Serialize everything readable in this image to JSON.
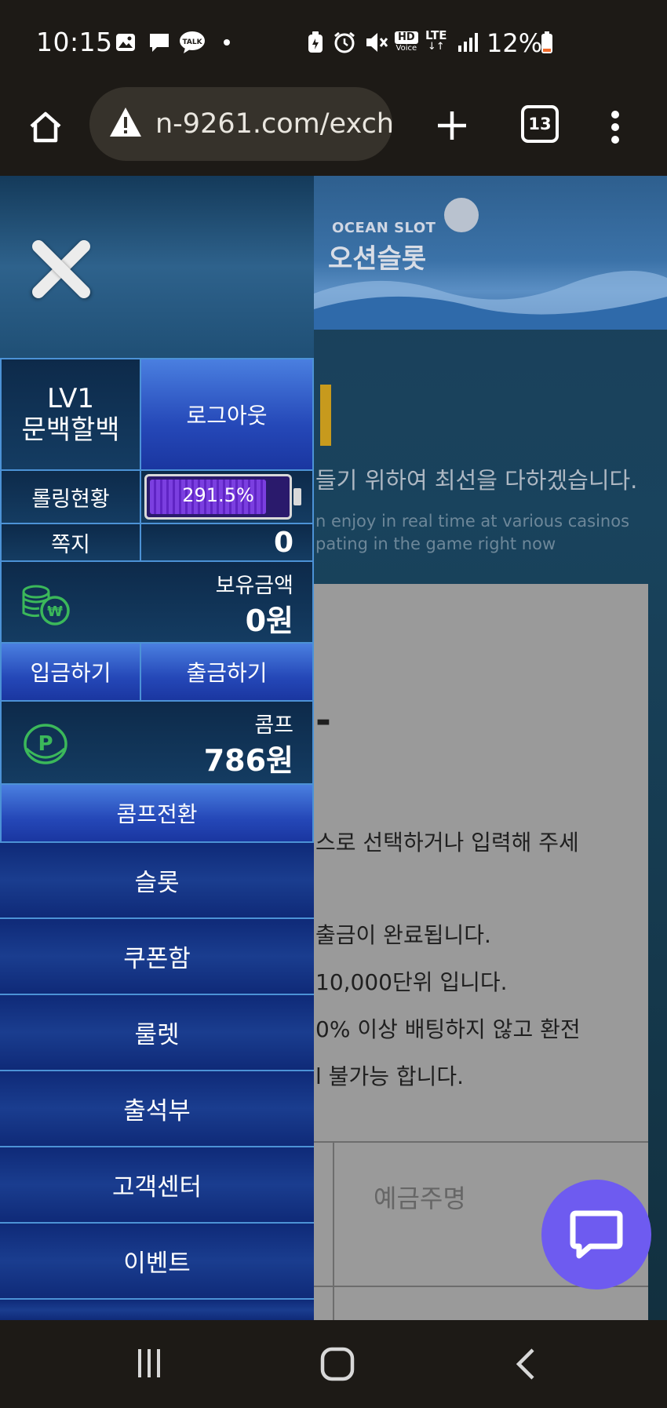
{
  "status_bar": {
    "time": "10:15",
    "battery_percent": "12%",
    "hd_label": "HD",
    "voice_label": "Voice",
    "lte_label": "LTE",
    "talk_label": "TALK"
  },
  "browser": {
    "url": "n-9261.com/exch",
    "tab_count": "13"
  },
  "site": {
    "logo_en": "OCEAN SLOT",
    "logo_ko": "오션슬롯",
    "tagline_ko": "들기 위하여 최선을 다하겠습니다.",
    "tagline_en_1": "n enjoy in real time at various casinos",
    "tagline_en_2": "pating in the game right now",
    "content_heading": "-",
    "content_lines": [
      "스로 선택하거나 입력해 주세",
      "출금이 완료됩니다.",
      "10,000단위 입니다.",
      "0% 이상 배팅하지 않고 환전",
      "l 불가능 합니다."
    ],
    "table_header": "예금주명"
  },
  "side_menu": {
    "level": "LV1",
    "username": "문백할백",
    "logout_label": "로그아웃",
    "rolling_label": "롤링현황",
    "rolling_value": "291.5%",
    "rolling_fill_fraction": 0.85,
    "message_label": "쪽지",
    "message_count": "0",
    "balance_label": "보유금액",
    "balance_value": "0원",
    "deposit_label": "입금하기",
    "withdraw_label": "출금하기",
    "comp_label": "콤프",
    "comp_value": "786원",
    "comp_convert_label": "콤프전환",
    "items": [
      "슬롯",
      "쿠폰함",
      "룰렛",
      "출석부",
      "고객센터",
      "이벤트"
    ]
  },
  "colors": {
    "accent_blue": "#4c92d6",
    "chat_purple": "#6e5bf0",
    "coin_green": "#3bb85a",
    "gauge_purple": "#7b3fe0"
  },
  "icons": {
    "home": "home-icon",
    "warning": "warning-icon",
    "new_tab": "plus-icon",
    "menu": "more-vert-icon",
    "close": "close-icon",
    "won_coin": "won-coin-icon",
    "p_coin": "point-coin-icon",
    "chat": "chat-icon"
  }
}
